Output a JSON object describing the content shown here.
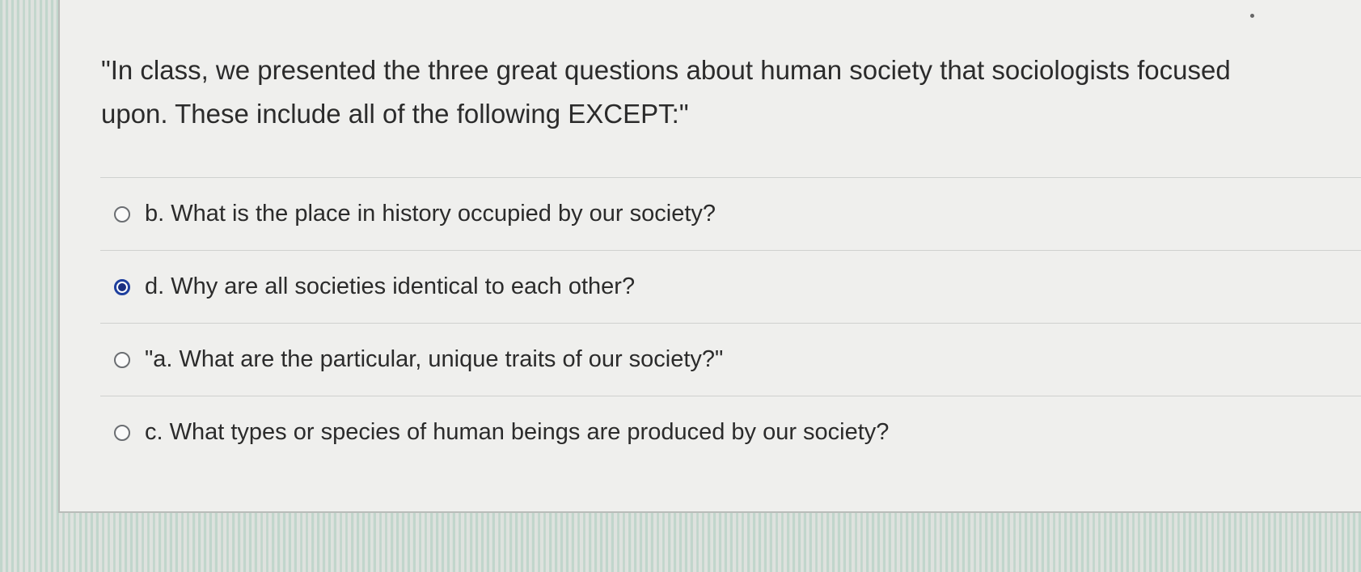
{
  "question": {
    "text": "\"In class, we presented the three great questions about human society that sociologists focused upon. These include all of the following EXCEPT:\""
  },
  "answers": [
    {
      "label": "b. What is the place in history occupied by our society?",
      "selected": false
    },
    {
      "label": "d. Why are all societies identical to each other?",
      "selected": true
    },
    {
      "label": "\"a. What are the particular, unique traits of our society?\"",
      "selected": false
    },
    {
      "label": "c. What types or species of human beings are produced by our society?",
      "selected": false
    }
  ],
  "colors": {
    "selected_radio": "#1e3f9e",
    "panel_background": "#efefed",
    "text": "#2b2b2b"
  }
}
